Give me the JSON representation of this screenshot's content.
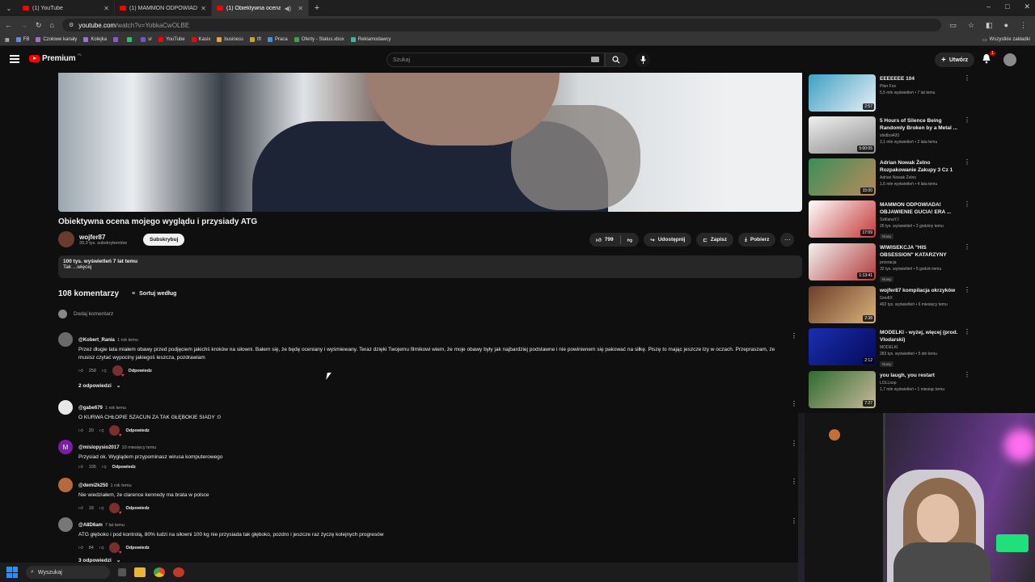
{
  "browser": {
    "tabs": [
      {
        "title": "(1) YouTube",
        "active": false
      },
      {
        "title": "(1) MAMMON ODPOWIADA! O",
        "active": false
      },
      {
        "title": "(1) Obiektywna ocena moje",
        "active": true
      }
    ],
    "new_tab": "+",
    "window_controls": [
      "–",
      "□",
      "✕"
    ],
    "url_host": "youtube.com",
    "url_path": "/watch?v=YobkaCwOLBE",
    "bookmarks": [
      "FB",
      "Czołowe kanały",
      "Kolejka",
      "",
      "",
      "sr",
      "YouTube",
      "Kasix",
      "business",
      "tft",
      "Praca",
      "Oferty - Status.xbox",
      "Reklamodawcy"
    ],
    "all_bookmarks": "Wszystkie zakładki"
  },
  "header": {
    "logo_text": "Premium",
    "country": "PL",
    "search_placeholder": "Szukaj",
    "create_label": "Utwórz",
    "notifications_count": "1"
  },
  "video": {
    "title": "Obiektywna ocena mojego wyglądu i przysiady ATG",
    "channel_name": "wojfer87",
    "subscribers": "39,3 tys. subskrybentów",
    "subscribe_label": "Subskrybuj",
    "likes": "799",
    "share_label": "Udostępnij",
    "save_label": "Zapisz",
    "download_label": "Pobierz",
    "views_age": "100 tys. wyświetleń  7 lat temu",
    "description_snippet": "Tak ...więcej"
  },
  "comments": {
    "count_label": "108 komentarzy",
    "sort_label": "Sortuj według",
    "add_placeholder": "Dodaj komentarz",
    "reply_label": "Odpowiedz",
    "items": [
      {
        "author": "@Kobert_Rania",
        "time": "1 rok temu",
        "text": "Przez długie lata miałem obawy przed podjęciem jakichś kroków na siłowni. Bałem się, że będę oceniany i wyśmiewany. Teraz dzięki Twojemu filmikowi wiem, że moje obawy były jak najbardziej podstawne i nie powinienem się pakować na siłkę. Piszę to mając jeszcze łzy w oczach. Przepraszam, że musisz czytać wypociny jakiegoś leszcza, pozdrawiam",
        "likes": "258",
        "avatar_color": "#6a6a6a",
        "replies": "2 odpowiedzi"
      },
      {
        "author": "@gabe679",
        "time": "1 rok temu",
        "text": "O KURWA CHŁOPIE SZACUN ZA TAK GŁĘBOKIE SIADY :0",
        "likes": "20",
        "avatar_color": "#e8e8e8"
      },
      {
        "author": "@mislopysio2017",
        "time": "10 miesięcy temu",
        "text": "Przysiad ok. Wyglądem przypominasz wirusa komputerowego",
        "likes": "105",
        "avatar_color": "#7b1fa2"
      },
      {
        "author": "@demi2k250",
        "time": "1 rok temu",
        "text": "Nie wiedziałem, że clarence kennedy ma brata w polsce",
        "likes": "18",
        "avatar_color": "#b46a3c"
      },
      {
        "author": "@A8D6am",
        "time": "7 lat temu",
        "text": "ATG głęboko i pod kontrolą, 80% ludzi na siłowni 100 kg nie przysiada tak głęboko, pozdro i jeszcze raz życzę kolejnych progresów",
        "likes": "84",
        "avatar_color": "#777777"
      }
    ],
    "next_replies": "3 odpowiedzi"
  },
  "sidebar": {
    "items": [
      {
        "title": "EEEEEEE 104",
        "channel": "Piter Fox",
        "meta": "5,5 mln wyświetleń • 7 lat temu",
        "duration": "2:57",
        "thumb_colors": [
          "#3fa0c4",
          "#e8f0f5"
        ]
      },
      {
        "title": "5 Hours of Silence Being Randomly Broken by a Metal ...",
        "channel": "shidboi420",
        "meta": "3,1 mln wyświetleń • 2 lata temu",
        "duration": "5:00:05",
        "thumb_colors": [
          "#d9d9d9",
          "#8d8d8d"
        ]
      },
      {
        "title": "Adrian Nowak Żelno Rozpakowanie Zakupy 3 Cz 1",
        "channel": "Adrian Nowak Żelno",
        "meta": "1,6 mln wyświetleń • 4 lata temu",
        "duration": "15:00",
        "thumb_colors": [
          "#3a8f5a",
          "#b98a5a"
        ]
      },
      {
        "title": "MAMMON ODPOWIADA! OBJAWIENIE GUCIA! ERA ...",
        "channel": "SzklanaYJ",
        "meta": "26 tys. wyświetleń • 2 godziny temu",
        "duration": "17:09",
        "new": "Nowy",
        "thumb_colors": [
          "#c43a3a",
          "#ffffff"
        ]
      },
      {
        "title": "WIWISEKCJA \"HIS OBSESSION\" KATARZYNY ROMANOWSKIEJ",
        "channel": "prosracja",
        "meta": "32 tys. wyświetleń • 5 godzin temu",
        "duration": "1:13:41",
        "new": "Nowy",
        "thumb_colors": [
          "#f2f2f2",
          "#b33a3a"
        ]
      },
      {
        "title": "wojfer87 kompilacja okrzyków",
        "channel": "GredIX",
        "meta": "492 tys. wyświetleń • 6 miesięcy temu",
        "duration": "2:38",
        "thumb_colors": [
          "#6b3f2a",
          "#d9b27a"
        ]
      },
      {
        "title": "MODELKI - wyżej, więcej (prod. Vlodarski)",
        "channel": "MODELKI",
        "meta": "283 tys. wyświetleń • 5 dni temu",
        "duration": "2:12",
        "new": "Nowy",
        "thumb_colors": [
          "#1a2fb0",
          "#050a5a"
        ]
      },
      {
        "title": "you laugh, you restart",
        "channel": "LOLLoop",
        "meta": "1,7 mln wyświetleń • 1 miesiąc temu",
        "duration": "7:27",
        "thumb_colors": [
          "#2f6b2f",
          "#c8b89a"
        ]
      }
    ]
  },
  "taskbar": {
    "search_placeholder": "Wyszukaj"
  }
}
